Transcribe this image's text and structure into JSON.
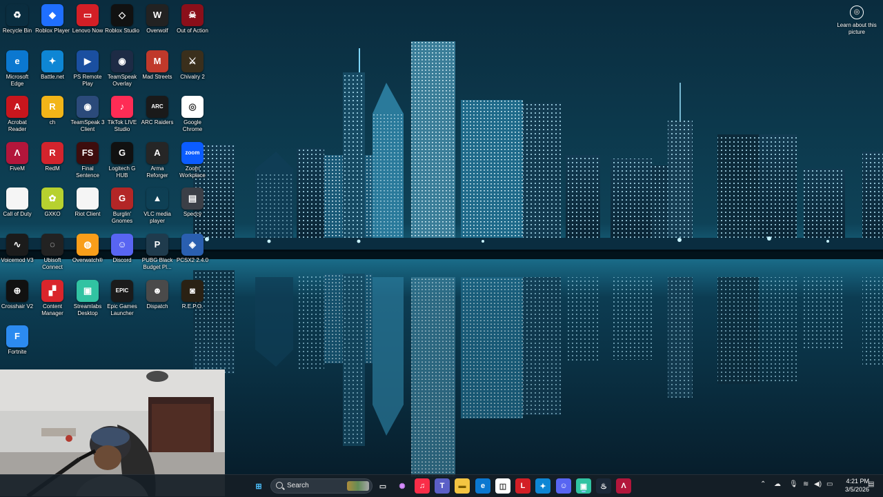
{
  "desktop_icons": [
    {
      "label": "Recycle Bin",
      "icon": "recycle-bin-icon",
      "bg": "transparent",
      "glyph": "♻"
    },
    {
      "label": "Roblox Player",
      "icon": "roblox-player-icon",
      "bg": "#1f6fff",
      "glyph": "◆"
    },
    {
      "label": "Lenovo Now",
      "icon": "lenovo-now-icon",
      "bg": "#d31f26",
      "glyph": "▭"
    },
    {
      "label": "Roblox Studio",
      "icon": "roblox-studio-icon",
      "bg": "#111111",
      "glyph": "◇"
    },
    {
      "label": "Overwolf",
      "icon": "overwolf-icon",
      "bg": "#222222",
      "glyph": "W"
    },
    {
      "label": "Out of Action",
      "icon": "out-of-action-icon",
      "bg": "#8a0f1a",
      "glyph": "☠"
    },
    {
      "label": "Microsoft Edge",
      "icon": "edge-icon",
      "bg": "#0b78d0",
      "glyph": "e"
    },
    {
      "label": "Battle.net",
      "icon": "battlenet-icon",
      "bg": "#0e86d4",
      "glyph": "✦"
    },
    {
      "label": "PS Remote Play",
      "icon": "ps-remote-play-icon",
      "bg": "#1a4fa0",
      "glyph": "▶"
    },
    {
      "label": "TeamSpeak Overlay",
      "icon": "teamspeak-overlay-icon",
      "bg": "#1d2b45",
      "glyph": "◉"
    },
    {
      "label": "Mad Streets",
      "icon": "mad-streets-icon",
      "bg": "#c0392b",
      "glyph": "M"
    },
    {
      "label": "Chivalry 2",
      "icon": "chivalry-2-icon",
      "bg": "#3a2f1c",
      "glyph": "⚔"
    },
    {
      "label": "Acrobat Reader",
      "icon": "acrobat-reader-icon",
      "bg": "#c8161d",
      "glyph": "A"
    },
    {
      "label": "ch",
      "icon": "rockstar-icon",
      "bg": "#f2b518",
      "glyph": "R"
    },
    {
      "label": "TeamSpeak 3 Client",
      "icon": "teamspeak-3-icon",
      "bg": "#2b4a7a",
      "glyph": "◉"
    },
    {
      "label": "TikTok LIVE Studio",
      "icon": "tiktok-live-icon",
      "bg": "#fe2c55",
      "glyph": "♪"
    },
    {
      "label": "ARC Raiders",
      "icon": "arc-raiders-icon",
      "bg": "#1a1a1a",
      "glyph": "ARC"
    },
    {
      "label": "Google Chrome",
      "icon": "chrome-icon",
      "bg": "#ffffff",
      "glyph": "◎"
    },
    {
      "label": "FiveM",
      "icon": "fivem-icon",
      "bg": "#b3163b",
      "glyph": "Λ"
    },
    {
      "label": "RedM",
      "icon": "redm-icon",
      "bg": "#d3242d",
      "glyph": "R"
    },
    {
      "label": "Final Sentence",
      "icon": "final-sentence-icon",
      "bg": "#3d0d0d",
      "glyph": "FS"
    },
    {
      "label": "Logitech G HUB",
      "icon": "logitech-g-hub-icon",
      "bg": "#111111",
      "glyph": "G"
    },
    {
      "label": "Arma Reforger",
      "icon": "arma-reforger-icon",
      "bg": "#262626",
      "glyph": "A"
    },
    {
      "label": "Zoom Workplace",
      "icon": "zoom-icon",
      "bg": "#0b5cff",
      "glyph": "zoom"
    },
    {
      "label": "Call of Duty",
      "icon": "call-of-duty-icon",
      "bg": "#f5f5f5",
      "glyph": ""
    },
    {
      "label": "GXKO",
      "icon": "gxko-icon",
      "bg": "#b7d12f",
      "glyph": "✿"
    },
    {
      "label": "Riot Client",
      "icon": "riot-client-icon",
      "bg": "#f5f5f5",
      "glyph": ""
    },
    {
      "label": "Burglin' Gnomes",
      "icon": "burglin-gnomes-icon",
      "bg": "#b32626",
      "glyph": "G"
    },
    {
      "label": "VLC media player",
      "icon": "vlc-icon",
      "bg": "transparent",
      "glyph": "▲"
    },
    {
      "label": "Speccy",
      "icon": "speccy-icon",
      "bg": "#3b3f47",
      "glyph": "▤"
    },
    {
      "label": "Voicemod V3",
      "icon": "voicemod-icon",
      "bg": "#1b1b1b",
      "glyph": "∿"
    },
    {
      "label": "Ubisoft Connect",
      "icon": "ubisoft-connect-icon",
      "bg": "#222222",
      "glyph": "◌"
    },
    {
      "label": "Overwatch®",
      "icon": "overwatch-icon",
      "bg": "#f99e1a",
      "glyph": "◍"
    },
    {
      "label": "Discord",
      "icon": "discord-icon",
      "bg": "#5865f2",
      "glyph": "☺"
    },
    {
      "label": "PUBG Black Budget Pl...",
      "icon": "pubg-black-budget-icon",
      "bg": "#1f3b4d",
      "glyph": "P"
    },
    {
      "label": "PCSX2 2.4.0",
      "icon": "pcsx2-icon",
      "bg": "#2a5fb0",
      "glyph": "◈"
    },
    {
      "label": "Crosshair V2",
      "icon": "crosshair-v2-icon",
      "bg": "#111111",
      "glyph": "⊕"
    },
    {
      "label": "Content Manager",
      "icon": "content-manager-icon",
      "bg": "#d9252b",
      "glyph": "▞"
    },
    {
      "label": "Streamlabs Desktop",
      "icon": "streamlabs-icon",
      "bg": "#31c3a2",
      "glyph": "▣"
    },
    {
      "label": "Epic Games Launcher",
      "icon": "epic-games-icon",
      "bg": "#1b1b1b",
      "glyph": "EPIC"
    },
    {
      "label": "Dispatch",
      "icon": "dispatch-icon",
      "bg": "#4a4a4a",
      "glyph": "☻"
    },
    {
      "label": "R.E.P.O.",
      "icon": "repo-icon",
      "bg": "#2a2114",
      "glyph": "◙"
    },
    {
      "label": "Fortnite",
      "icon": "fortnite-icon",
      "bg": "#2c8bf0",
      "glyph": "F"
    }
  ],
  "learn_picture": {
    "label": "Learn about this picture"
  },
  "taskbar": {
    "search_placeholder": "Search",
    "apps": [
      {
        "name": "start-button",
        "glyph": "⊞",
        "bg": "transparent",
        "color": "#4cc2ff"
      },
      {
        "name": "taskview-button",
        "glyph": "▭",
        "bg": "transparent",
        "color": "#ddd"
      },
      {
        "name": "copilot-button",
        "glyph": "✺",
        "bg": "transparent",
        "color": "#d68cff"
      },
      {
        "name": "apple-music-button",
        "glyph": "♫",
        "bg": "#fa2d48",
        "color": "#fff"
      },
      {
        "name": "teams-button",
        "glyph": "T",
        "bg": "#5b5fc7",
        "color": "#fff"
      },
      {
        "name": "file-explorer-button",
        "glyph": "▬",
        "bg": "#f4c542",
        "color": "#7a5a00"
      },
      {
        "name": "edge-taskbar-button",
        "glyph": "e",
        "bg": "#0b78d0",
        "color": "#fff"
      },
      {
        "name": "store-button",
        "glyph": "◫",
        "bg": "#ffffff",
        "color": "#333"
      },
      {
        "name": "lenovo-button",
        "glyph": "L",
        "bg": "#d31f26",
        "color": "#fff"
      },
      {
        "name": "battlenet-taskbar-button",
        "glyph": "✦",
        "bg": "#0e86d4",
        "color": "#fff"
      },
      {
        "name": "discord-taskbar-button",
        "glyph": "☺",
        "bg": "#5865f2",
        "color": "#fff"
      },
      {
        "name": "streamlabs-taskbar-button",
        "glyph": "▣",
        "bg": "#31c3a2",
        "color": "#fff"
      },
      {
        "name": "steam-button",
        "glyph": "♨",
        "bg": "#1b2838",
        "color": "#fff"
      },
      {
        "name": "fivem-taskbar-button",
        "glyph": "Λ",
        "bg": "#b3163b",
        "color": "#fff"
      }
    ],
    "tray": {
      "chevron": "⌃",
      "time": "4:21 PM",
      "date": "3/5/2026"
    }
  }
}
